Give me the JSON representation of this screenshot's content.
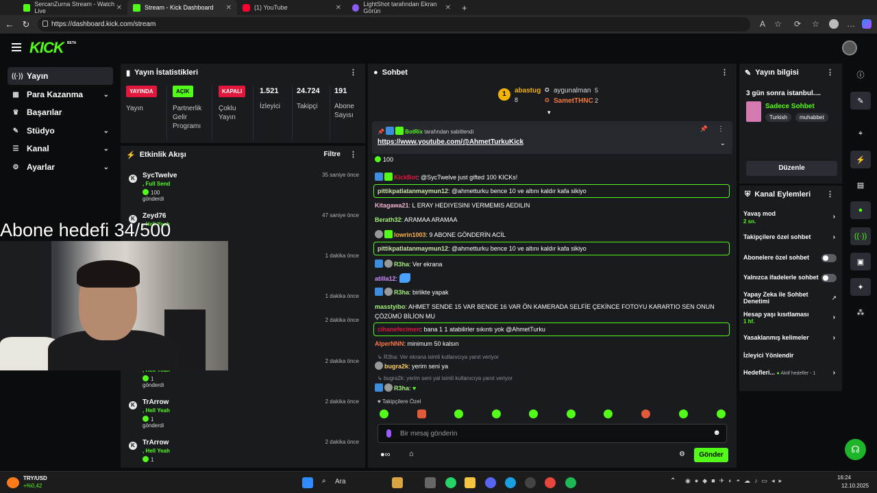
{
  "browser": {
    "tabs": [
      {
        "title": "SercanZurna Stream - Watch Live",
        "icon": "kick"
      },
      {
        "title": "Stream - Kick Dashboard",
        "icon": "kick"
      },
      {
        "title": "(1) YouTube",
        "icon": "yt"
      },
      {
        "title": "LightShot tarafından Ekran Görün",
        "icon": "ls"
      }
    ],
    "url": "https://dashboard.kick.com/stream"
  },
  "header": {
    "logo": "KICK",
    "beta": "BETA"
  },
  "sidebar": {
    "items": [
      {
        "label": "Yayın",
        "icon": "broadcast-icon",
        "active": true
      },
      {
        "label": "Para Kazanma",
        "icon": "money-icon",
        "chevron": true
      },
      {
        "label": "Başarılar",
        "icon": "trophy-icon"
      },
      {
        "label": "Stüdyo",
        "icon": "studio-icon",
        "chevron": true
      },
      {
        "label": "Kanal",
        "icon": "channel-icon",
        "chevron": true
      },
      {
        "label": "Ayarlar",
        "icon": "gear-icon",
        "chevron": true
      }
    ]
  },
  "stats": {
    "title": "Yayın İstatistikleri",
    "cols": [
      {
        "badge": "YAYINDA",
        "label": "Yayın",
        "type": "red"
      },
      {
        "badge": "AÇIK",
        "label": "Partnerlik Gelir Programı",
        "type": "green"
      },
      {
        "badge": "KAPALI",
        "label": "Çoklu Yayın",
        "type": "red"
      },
      {
        "value": "1.521",
        "label": "İzleyici"
      },
      {
        "value": "24.724",
        "label": "Takipçi"
      },
      {
        "value": "191",
        "label": "Abone Sayısı"
      }
    ]
  },
  "activity": {
    "title": "Etkinlik Akışı",
    "filter": "Filtre",
    "items": [
      {
        "name": "SycTwelve",
        "time": "35 saniye önce",
        "l2": ", Full Send",
        "l3": "100",
        "l4": "gönderdi"
      },
      {
        "name": "Zeyd76",
        "time": "47 saniye önce",
        "l2": ", Hell Yeah",
        "l3": "",
        "l4": ""
      },
      {
        "name": "",
        "time": "1 dakika önce",
        "l2": "",
        "l3": "",
        "l4": ""
      },
      {
        "name": "",
        "time": "1 dakika önce",
        "l2": "",
        "l3": "",
        "l4": ""
      },
      {
        "name": "",
        "time": "2 dakika önce",
        "l2": "",
        "l3": "",
        "l4": ""
      },
      {
        "name": "",
        "time": "2 dakika önce",
        "l2": ", Hell Yeah",
        "l3": "1",
        "l4": "gönderdi"
      },
      {
        "name": "TrArrow",
        "time": "2 dakika önce",
        "l2": ", Hell Yeah",
        "l3": "1",
        "l4": "gönderdi"
      },
      {
        "name": "TrArrow",
        "time": "2 dakika önce",
        "l2": ", Hell Yeah",
        "l3": "1",
        "l4": ""
      }
    ]
  },
  "overlay": {
    "text": "Abone hedefi 34/500"
  },
  "chat": {
    "title": "Sohbet",
    "top_gifters": [
      {
        "name": "abastug",
        "count": "8",
        "rank": "1"
      },
      {
        "name": "aygunalman",
        "count": "5"
      },
      {
        "name": "SametTHNC",
        "count": "2"
      }
    ],
    "pinned": {
      "by": "BotRix",
      "suffix": "tarafından sabitlendi",
      "link": "https://www.youtube.com/@AhmetTurkuKick"
    },
    "gift_count": "100",
    "messages": [
      {
        "user": "KickBot",
        "text": ": @SycTwelve just gifted 100 KICKs!",
        "color": "#e1173c",
        "hl": false
      },
      {
        "user": "pittikpatlatanmaymun12",
        "text": ": @ahmetturku bence 10 ve altını kaldır kafa sikiyo",
        "color": "#cfe8a8",
        "hl": true
      },
      {
        "user": "Kitagawa21",
        "text": ": L ERAY HEDIYESINI VERMEMIS AEDILIN",
        "color": "#f4b6d0",
        "hl": false
      },
      {
        "user": "Berath32",
        "text": ": ARAMAA ARAMAA",
        "color": "#a6f07a",
        "hl": false
      },
      {
        "user": "lowrin1003",
        "text": ": 9 ABONE GÖNDERİN ACİL",
        "color": "#ffb347",
        "hl": false
      },
      {
        "user": "pittikpatlatanmaymun12",
        "text": ": @ahmetturku bence 10 ve altını kaldır kafa sikiyo",
        "color": "#cfe8a8",
        "hl": true
      },
      {
        "user": "R3ha",
        "text": ": Ver ekrana",
        "color": "#a6f07a",
        "hl": false
      },
      {
        "user": "atilla12",
        "text": ":",
        "color": "#d18cff",
        "hl": false
      },
      {
        "user": "R3ha",
        "text": ": birlikte yapak",
        "color": "#a6f07a",
        "hl": false
      },
      {
        "user": "masstyibo",
        "text": ": AHMET SENDE 15 VAR BENDE 16 VAR ÖN KAMERADA SELFİE ÇEKİNCE FOTOYU KARARTIO SEN ONUN",
        "text2": "ÇÖZÜMÜ BİLİON MU",
        "color": "#a6f07a",
        "hl": false
      },
      {
        "user": "cihanefecimen",
        "text": ": bana 1 1 atabilirler sıkıntı yok @AhmetTurku",
        "color": "#e1173c",
        "hl": true
      },
      {
        "user": "AlperNNN",
        "text": ": minimum 50 kalsın",
        "color": "#ff7a45",
        "hl": false
      },
      {
        "reply": "R3ha: Ver ekrana isimli kullanıcıya yanıt veriyor"
      },
      {
        "user": "bugra2k",
        "text": ": yerim seni ya",
        "color": "#ffd166",
        "hl": false
      },
      {
        "reply": "bugra2k: yerim seni yal isimli kullanıcıya yanıt veriyor"
      },
      {
        "user": "R3ha",
        "text": ":",
        "color": "#a6f07a",
        "hl": false
      }
    ],
    "followers_only": "Takipçilere Özel",
    "input_placeholder": "Bir mesaj gönderin",
    "send": "Gönder"
  },
  "stream_info": {
    "title": "Yayın bilgisi",
    "stream_title": "3 gün sonra istanbul....",
    "category": "Sadece Sohbet",
    "tags": [
      "Turkish",
      "muhabbet"
    ],
    "edit": "Düzenle"
  },
  "channel_actions": {
    "title": "Kanal Eylemleri",
    "items": [
      {
        "label": "Yavaş mod",
        "sub": "2 sn.",
        "control": "chevron"
      },
      {
        "label": "Takipçilere özel sohbet",
        "control": "chevron"
      },
      {
        "label": "Abonelere özel sohbet",
        "control": "toggle"
      },
      {
        "label": "Yalnızca ifadelerle sohbet",
        "control": "toggle"
      },
      {
        "label": "Yapay Zeka ile Sohbet Denetimi",
        "control": "external"
      },
      {
        "label": "Hesap yaşı kısıtlaması",
        "sub": "1 hf.",
        "control": "chevron"
      },
      {
        "label": "Yasaklanmış kelimeler",
        "control": "chevron"
      },
      {
        "label": "İzleyici Yönlendir",
        "control": "none"
      },
      {
        "label": "Hedefleri...",
        "sub": "Aktif hedefler - 1",
        "control": "chevron"
      }
    ]
  },
  "taskbar": {
    "stock": "TRY/USD",
    "stock_change": "+%0,42",
    "search": "Ara",
    "time": "16:24",
    "date": "12.10.2025"
  },
  "colors": {
    "accent": "#53fc18",
    "live": "#e1173c",
    "panel": "#191b1f",
    "bg": "#0b0c0d"
  }
}
